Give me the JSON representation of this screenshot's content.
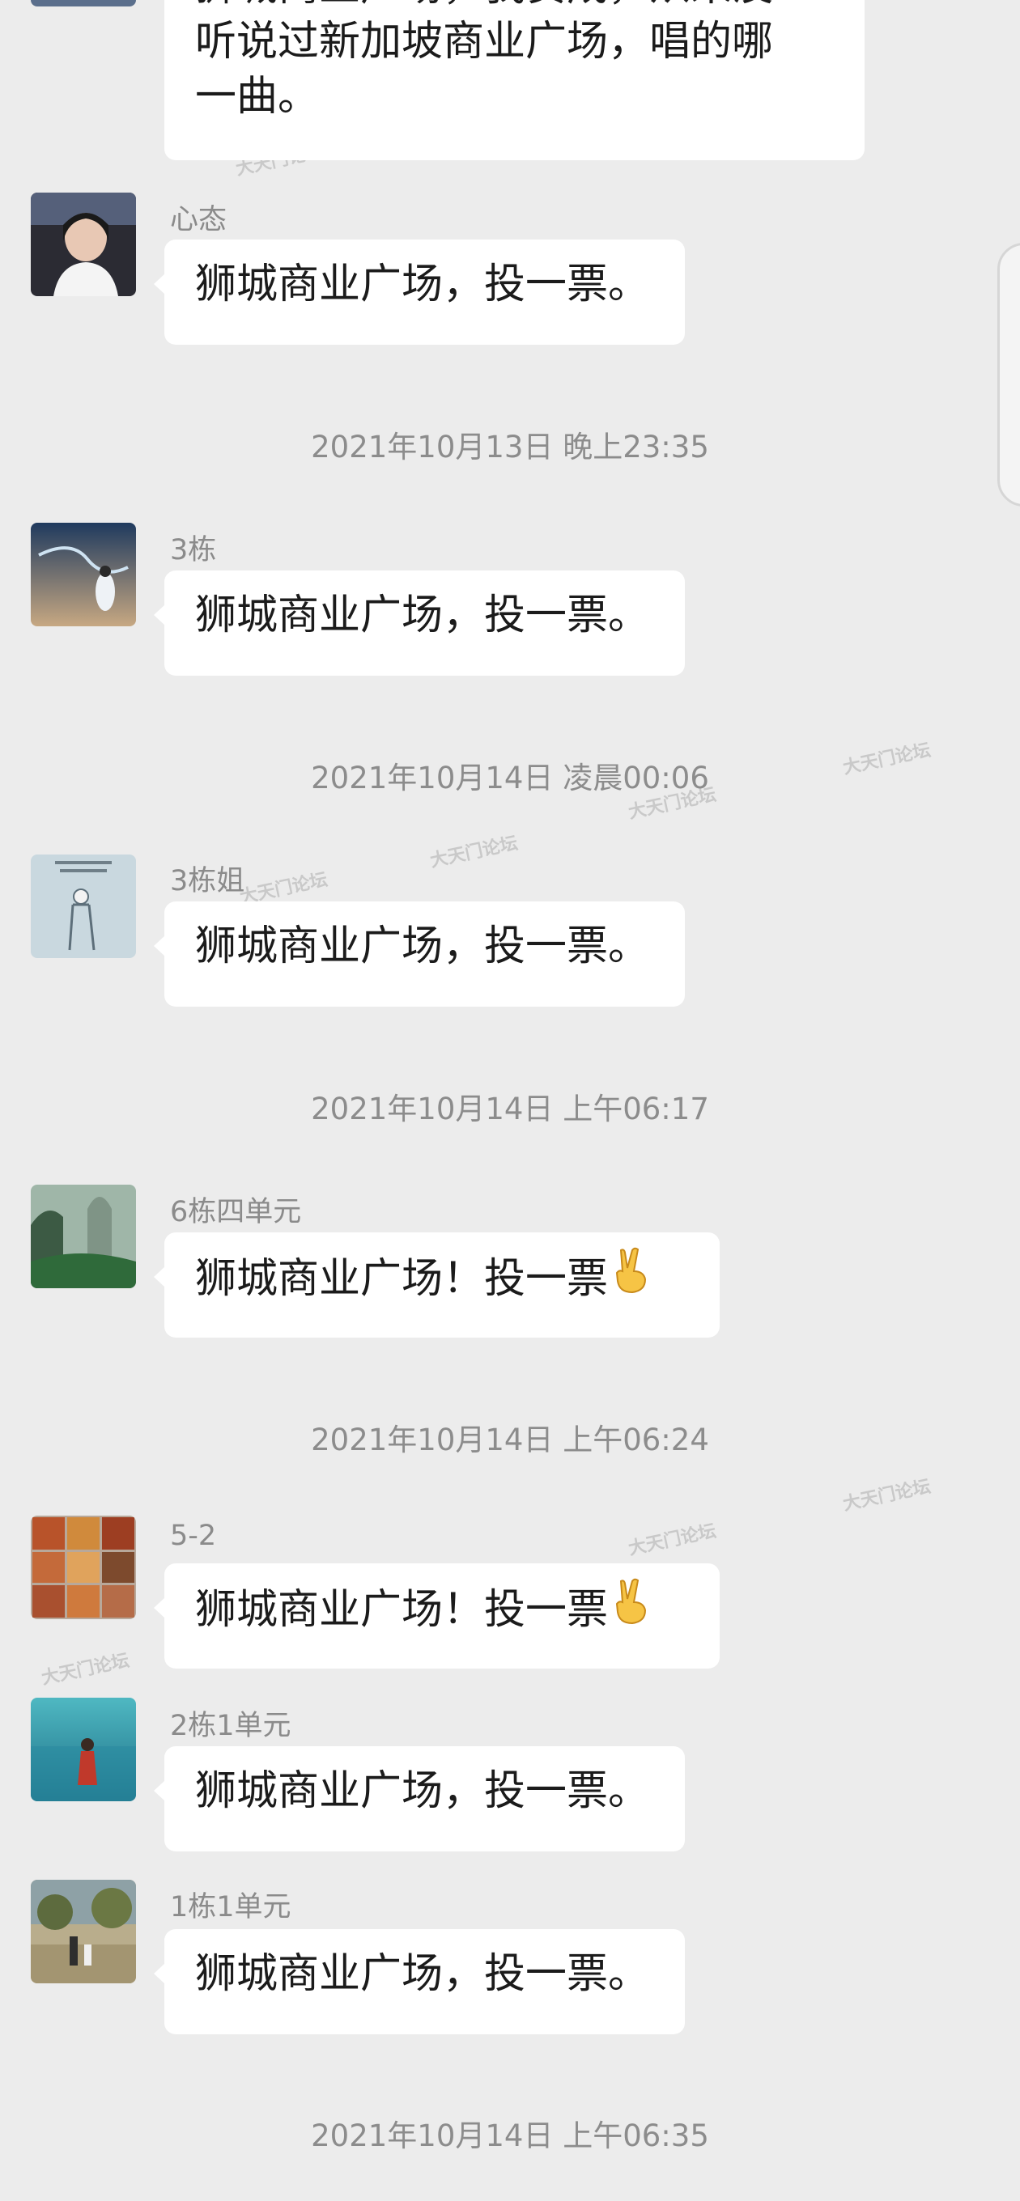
{
  "messages": [
    {
      "id": "m0",
      "lines": [
        "狮城商业广场，我赞成，从来没",
        "听说过新加坡商业广场，唱的哪",
        "一曲。"
      ]
    },
    {
      "id": "m1",
      "sender": "心态",
      "text": "狮城商业广场，投一票。"
    },
    {
      "id": "m2",
      "sender": "3栋",
      "text": "狮城商业广场，投一票。"
    },
    {
      "id": "m3",
      "sender": "3栋姐",
      "text": "狮城商业广场，投一票。"
    },
    {
      "id": "m4",
      "sender": "6栋四单元",
      "text": "狮城商业广场！投一票"
    },
    {
      "id": "m5",
      "sender": "5-2",
      "text": "狮城商业广场！投一票"
    },
    {
      "id": "m6",
      "sender": "2栋1单元",
      "text": "狮城商业广场，投一票。"
    },
    {
      "id": "m7",
      "sender": "1栋1单元",
      "text": "狮城商业广场，投一票。"
    }
  ],
  "timestamps": {
    "t1": "2021年10月13日 晚上23:35",
    "t2": "2021年10月14日 凌晨00:06",
    "t3": "2021年10月14日 上午06:17",
    "t4": "2021年10月14日 上午06:24",
    "t5": "2021年10月14日 上午06:35"
  },
  "watermark": "大天门论坛",
  "icons": {
    "victory": "victory-hand-emoji"
  },
  "colors": {
    "background": "#ececec",
    "bubble": "#ffffff",
    "meta_text": "#8c8c8c"
  }
}
